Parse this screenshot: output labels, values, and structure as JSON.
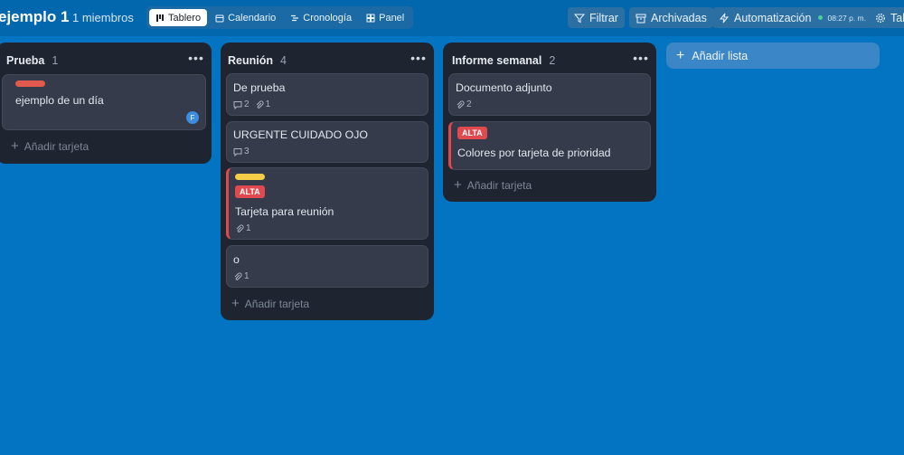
{
  "header": {
    "board_title": "ejemplo 1",
    "members": "1 miembros",
    "views": [
      {
        "label": "Tablero",
        "icon": "board-icon",
        "active": true
      },
      {
        "label": "Calendario",
        "icon": "calendar-icon",
        "active": false
      },
      {
        "label": "Cronología",
        "icon": "timeline-icon",
        "active": false
      },
      {
        "label": "Panel",
        "icon": "dashboard-icon",
        "active": false
      }
    ],
    "filter_label": "Filtrar",
    "archived_label": "Archivadas",
    "automation_label": "Automatización",
    "automation_time": "08:27 p. m.",
    "settings_label": "Tab"
  },
  "lists": [
    {
      "title": "Prueba",
      "count": "1",
      "add_card": "Añadir tarjeta",
      "cards": [
        {
          "title": "ejemplo de un día",
          "label_color": "#e2594d",
          "avatar": "F"
        }
      ]
    },
    {
      "title": "Reunión",
      "count": "4",
      "add_card": "Añadir tarjeta",
      "cards": [
        {
          "title": "De prueba",
          "comments": "2",
          "attachments": "1"
        },
        {
          "title": "URGENTE CUIDADO OJO",
          "comments": "3"
        },
        {
          "title": "Tarjeta para reunión",
          "label_color": "#f5cd47",
          "priority": "ALTA",
          "attachments": "1"
        },
        {
          "title": "o",
          "attachments": "1"
        }
      ]
    },
    {
      "title": "Informe semanal",
      "count": "2",
      "add_card": "Añadir tarjeta",
      "cards": [
        {
          "title": "Documento adjunto",
          "attachments": "2"
        },
        {
          "title": "Colores por tarjeta de prioridad",
          "priority": "ALTA"
        }
      ]
    }
  ],
  "add_list": "Añadir lista",
  "colors": {
    "board_bg": "#0274c2",
    "list_bg": "#1f2530",
    "card_bg": "#363b4b",
    "priority_red": "#e04a4f"
  }
}
